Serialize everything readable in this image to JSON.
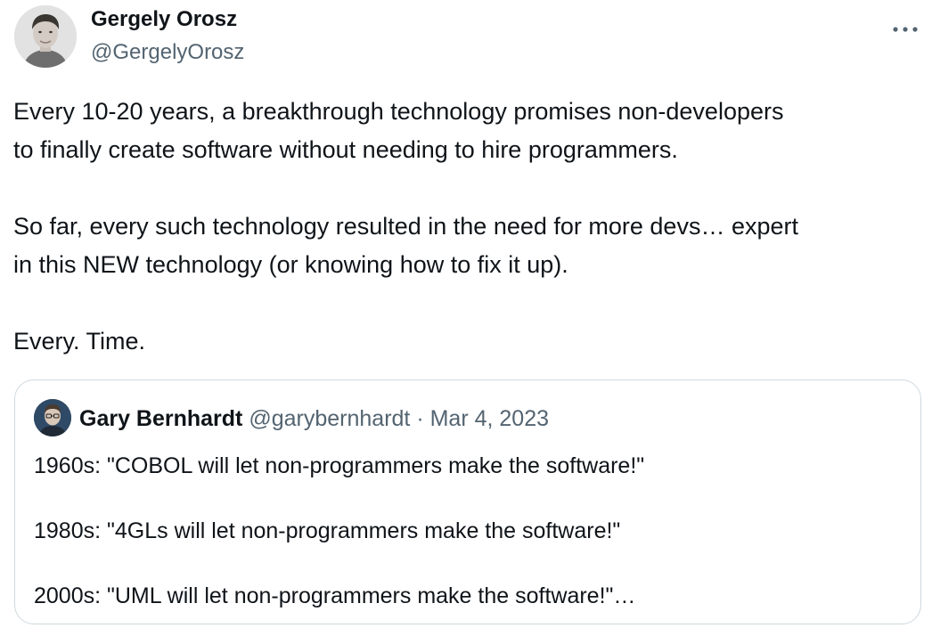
{
  "author": {
    "name": "Gergely Orosz",
    "handle": "@GergelyOrosz"
  },
  "more_label": "···",
  "tweet": {
    "paragraphs": [
      [
        "Every 10-20 years, a breakthrough technology promises non-developers",
        "to finally create software without needing to hire programmers."
      ],
      [
        "So far, every such technology resulted in the need for more devs… expert",
        "in this NEW technology (or knowing how to fix it up)."
      ],
      [
        "Every. Time."
      ]
    ]
  },
  "quote": {
    "name": "Gary Bernhardt",
    "handle": "@garybernhardt",
    "separator": "·",
    "date": "Mar 4, 2023",
    "lines": [
      "1960s: \"COBOL will let non-programmers make the software!\"",
      "1980s: \"4GLs will let non-programmers make the software!\"",
      "2000s: \"UML will let non-programmers make the software!\"…"
    ]
  }
}
